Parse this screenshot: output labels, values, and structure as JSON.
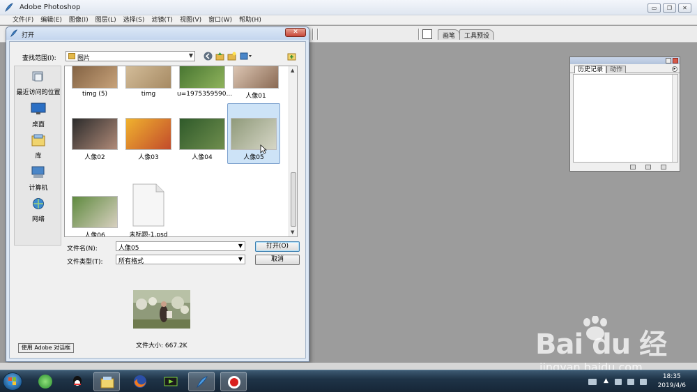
{
  "app": {
    "title": "Adobe Photoshop",
    "menu": [
      "文件(F)",
      "编辑(E)",
      "图像(I)",
      "图层(L)",
      "选择(S)",
      "滤镜(T)",
      "视图(V)",
      "窗口(W)",
      "帮助(H)"
    ],
    "window_buttons": {
      "minimize": "▭",
      "restore": "❐",
      "close": "✕"
    }
  },
  "palette_well": {
    "tabs": [
      "画笔",
      "工具预设"
    ]
  },
  "history_palette": {
    "tabs": [
      "历史记录",
      "动作"
    ]
  },
  "dialog": {
    "title": "打开",
    "close_label": "✕",
    "look_in_label": "查找范围(I):",
    "look_in_value": "图片",
    "places": [
      "最近访问的位置",
      "桌面",
      "库",
      "计算机",
      "网络"
    ],
    "files": [
      {
        "name": "timg (5)",
        "colors": [
          "#7a5a3c",
          "#c7a27a"
        ]
      },
      {
        "name": "timg",
        "colors": [
          "#d9c3a0",
          "#a68a63"
        ]
      },
      {
        "name": "u=1975359590...",
        "colors": [
          "#3f6e2c",
          "#8fb35c"
        ]
      },
      {
        "name": "人像01",
        "colors": [
          "#e7d2c0",
          "#8a6a54"
        ]
      },
      {
        "name": "人像02",
        "colors": [
          "#2b2b2b",
          "#b08a78"
        ]
      },
      {
        "name": "人像03",
        "colors": [
          "#f0b22e",
          "#c24b2c"
        ]
      },
      {
        "name": "人像04",
        "colors": [
          "#2f5a2a",
          "#6f8e4e"
        ]
      },
      {
        "name": "人像05",
        "colors": [
          "#8f9a7a",
          "#d6d6c6"
        ]
      },
      {
        "name": "人像06",
        "colors": [
          "#5f8a3f",
          "#d8d0c0"
        ]
      },
      {
        "name": "未标题-1.psd",
        "colors": [
          "#f4f4f4",
          "#e0e0e0"
        ]
      }
    ],
    "selected_file": "人像05",
    "filename_label": "文件名(N):",
    "filename_value": "人像05",
    "filetype_label": "文件类型(T):",
    "filetype_value": "所有格式",
    "open_button": "打开(O)",
    "cancel_button": "取消",
    "file_size": "文件大小: 667.2K",
    "adobe_dialog_button": "使用 Adobe 对话框"
  },
  "taskbar": {
    "time": "18:35",
    "date": "2019/4/6",
    "apps": [
      "ie-icon",
      "qq-icon",
      "explorer-icon",
      "firefox-icon",
      "media-icon",
      "photoshop-icon",
      "record-icon"
    ]
  },
  "watermark": {
    "main": "Bai du 经验",
    "sub": "jingyan.baidu.com"
  },
  "colors": {
    "accent": "#cde3f7",
    "taskbar": "#1f3448",
    "workspace": "#9c9c9c"
  }
}
